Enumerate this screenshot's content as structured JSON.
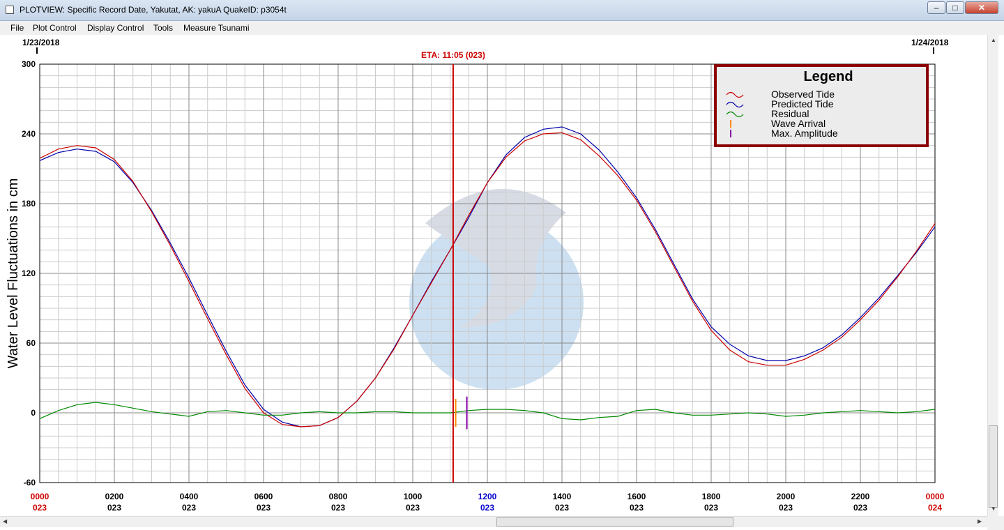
{
  "window": {
    "title": "PLOTVIEW: Specific Record Date, Yakutat, AK: yakuA     QuakeID: p3054t",
    "minimize_glyph": "–",
    "maximize_glyph": "□",
    "close_glyph": "✕"
  },
  "menu": {
    "items": [
      {
        "label": "File"
      },
      {
        "label": "Plot Control"
      },
      {
        "label": "Display Control"
      },
      {
        "label": "Tools"
      },
      {
        "label": "Measure Tsunami"
      }
    ]
  },
  "chart_data": {
    "type": "line",
    "title": "",
    "ylabel": "Water Level Fluctuations in cm",
    "ylim": [
      -60,
      300
    ],
    "yticks": [
      -60,
      0,
      60,
      120,
      180,
      240,
      300
    ],
    "xlim": [
      0,
      24
    ],
    "date_start": "1/23/2018",
    "date_end": "1/24/2018",
    "eta_label": "ETA: 11:05 (023)",
    "eta_hour": 11.083,
    "grid": true,
    "x_ticks": [
      {
        "x": 0,
        "time": "0000",
        "day": "023",
        "color": "#cc0000"
      },
      {
        "x": 2,
        "time": "0200",
        "day": "023",
        "color": "#000000"
      },
      {
        "x": 4,
        "time": "0400",
        "day": "023",
        "color": "#000000"
      },
      {
        "x": 6,
        "time": "0600",
        "day": "023",
        "color": "#000000"
      },
      {
        "x": 8,
        "time": "0800",
        "day": "023",
        "color": "#000000"
      },
      {
        "x": 10,
        "time": "1000",
        "day": "023",
        "color": "#000000"
      },
      {
        "x": 12,
        "time": "1200",
        "day": "023",
        "color": "#0000cc"
      },
      {
        "x": 14,
        "time": "1400",
        "day": "023",
        "color": "#000000"
      },
      {
        "x": 16,
        "time": "1600",
        "day": "023",
        "color": "#000000"
      },
      {
        "x": 18,
        "time": "1800",
        "day": "023",
        "color": "#000000"
      },
      {
        "x": 20,
        "time": "2000",
        "day": "023",
        "color": "#000000"
      },
      {
        "x": 22,
        "time": "2200",
        "day": "023",
        "color": "#000000"
      },
      {
        "x": 24,
        "time": "0000",
        "day": "024",
        "color": "#cc0000"
      }
    ],
    "legend": {
      "title": "Legend",
      "placement": "top-right",
      "entries": [
        {
          "name": "Observed Tide",
          "color": "#cc0000",
          "marker": "wave"
        },
        {
          "name": "Predicted Tide",
          "color": "#0000aa",
          "marker": "wave"
        },
        {
          "name": "Residual",
          "color": "#008800",
          "marker": "wave"
        },
        {
          "name": "Wave Arrival",
          "color": "#ff8800",
          "marker": "bar"
        },
        {
          "name": "Max. Amplitude",
          "color": "#8800aa",
          "marker": "bar"
        }
      ]
    },
    "series": [
      {
        "name": "Predicted Tide",
        "color": "#0000aa",
        "x": [
          0,
          0.5,
          1,
          1.5,
          2,
          2.5,
          3,
          3.5,
          4,
          4.5,
          5,
          5.5,
          6,
          6.5,
          7,
          7.5,
          8,
          8.5,
          9,
          9.5,
          10,
          10.5,
          11,
          11.5,
          12,
          12.5,
          13,
          13.5,
          14,
          14.5,
          15,
          15.5,
          16,
          16.5,
          17,
          17.5,
          18,
          18.5,
          19,
          19.5,
          20,
          20.5,
          21,
          21.5,
          22,
          22.5,
          23,
          23.5,
          24
        ],
        "y": [
          217,
          224,
          227,
          225,
          216,
          198,
          174,
          146,
          116,
          84,
          53,
          24,
          3,
          -8,
          -12,
          -11,
          -4,
          10,
          30,
          56,
          84,
          113,
          140,
          168,
          198,
          222,
          237,
          244,
          246,
          240,
          226,
          207,
          185,
          158,
          128,
          98,
          74,
          59,
          49,
          45,
          45,
          49,
          56,
          67,
          82,
          99,
          118,
          138,
          160
        ]
      },
      {
        "name": "Observed Tide",
        "color": "#cc0000",
        "x": [
          0,
          0.5,
          1,
          1.5,
          2,
          2.5,
          3,
          3.5,
          4,
          4.5,
          5,
          5.5,
          6,
          6.5,
          7,
          7.5,
          8,
          8.5,
          9,
          9.5,
          10,
          10.5,
          11,
          11.5,
          12,
          12.5,
          13,
          13.5,
          14,
          14.5,
          15,
          15.5,
          16,
          16.5,
          17,
          17.5,
          18,
          18.5,
          19,
          19.5,
          20,
          20.5,
          21,
          21.5,
          22,
          22.5,
          23,
          23.5,
          24
        ],
        "y": [
          219,
          227,
          230,
          228,
          218,
          199,
          173,
          144,
          113,
          81,
          50,
          21,
          0,
          -10,
          -12,
          -11,
          -4,
          10,
          30,
          55,
          84,
          112,
          140,
          170,
          198,
          220,
          234,
          240,
          241,
          235,
          221,
          204,
          183,
          156,
          126,
          96,
          71,
          54,
          44,
          41,
          41,
          46,
          54,
          65,
          80,
          97,
          117,
          139,
          163
        ]
      },
      {
        "name": "Residual",
        "color": "#008800",
        "x": [
          0,
          0.5,
          1,
          1.5,
          2,
          2.5,
          3,
          3.5,
          4,
          4.5,
          5,
          5.5,
          6,
          6.5,
          7,
          7.5,
          8,
          8.5,
          9,
          9.5,
          10,
          10.5,
          11,
          11.5,
          12,
          12.5,
          13,
          13.5,
          14,
          14.5,
          15,
          15.5,
          16,
          16.5,
          17,
          17.5,
          18,
          18.5,
          19,
          19.5,
          20,
          20.5,
          21,
          21.5,
          22,
          22.5,
          23,
          23.5,
          24
        ],
        "y": [
          -5,
          2,
          7,
          9,
          7,
          4,
          1,
          -1,
          -3,
          1,
          2,
          0,
          -2,
          -2,
          0,
          1,
          0,
          0,
          1,
          1,
          0,
          0,
          0,
          2,
          3,
          3,
          2,
          0,
          -5,
          -6,
          -4,
          -3,
          2,
          3,
          0,
          -2,
          -2,
          -1,
          0,
          -1,
          -3,
          -2,
          0,
          1,
          2,
          1,
          0,
          1,
          3
        ]
      }
    ],
    "wave_arrival_hour": 11.15,
    "max_amplitude_hour": 11.45
  }
}
